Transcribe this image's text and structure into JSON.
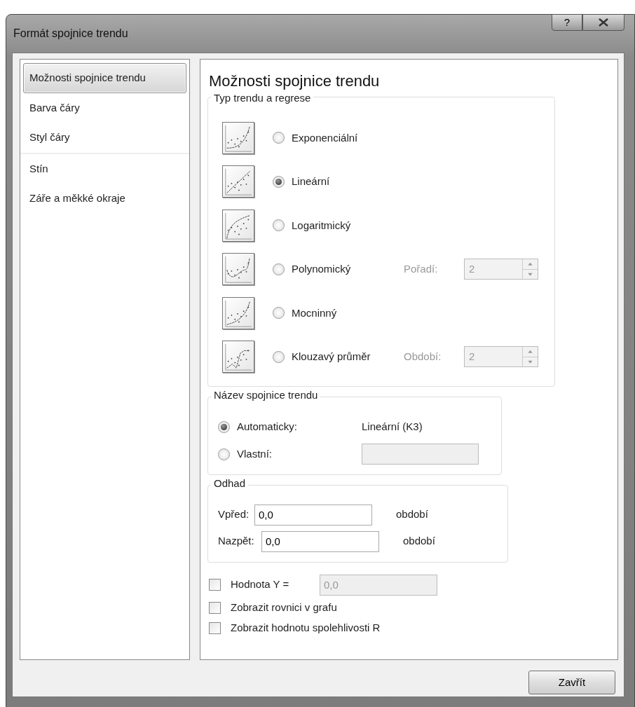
{
  "window": {
    "title": "Formát spojnice trendu",
    "help": "?"
  },
  "sidebar": {
    "items": [
      {
        "label": "Možnosti spojnice trendu",
        "selected": true,
        "divider_before": false
      },
      {
        "label": "Barva čáry",
        "selected": false,
        "divider_before": false
      },
      {
        "label": "Styl čáry",
        "selected": false,
        "divider_before": false
      },
      {
        "label": "Stín",
        "selected": false,
        "divider_before": true
      },
      {
        "label": "Záře a měkké okraje",
        "selected": false,
        "divider_before": false
      }
    ]
  },
  "panel": {
    "title": "Možnosti spojnice trendu",
    "trend_type": {
      "title": "Typ trendu a regrese",
      "options": [
        {
          "kind": "exponential",
          "label": "Exponenciální",
          "selected": false
        },
        {
          "kind": "linear",
          "label": "Lineární",
          "selected": true
        },
        {
          "kind": "logarithmic",
          "label": "Logaritmický",
          "selected": false
        },
        {
          "kind": "polynomial",
          "label": "Polynomický",
          "selected": false,
          "parameter": {
            "label": "Pořadí:",
            "value": "2",
            "disabled": true
          }
        },
        {
          "kind": "power",
          "label": "Mocninný",
          "selected": false
        },
        {
          "kind": "moving_average",
          "label": "Klouzavý průměr",
          "selected": false,
          "parameter": {
            "label": "Období:",
            "value": "2",
            "disabled": true
          }
        }
      ]
    },
    "trend_name": {
      "title": "Název spojnice trendu",
      "options": [
        {
          "kind": "text",
          "label": "Automaticky:",
          "selected": true,
          "value": "Lineární (K3)"
        },
        {
          "kind": "field",
          "label": "Vlastní:",
          "selected": false,
          "disabled": true
        }
      ]
    },
    "forecast": {
      "title": "Odhad",
      "rows": [
        {
          "label": "Vpřed:",
          "value": "0,0",
          "unit": "období"
        },
        {
          "label": "Nazpět:",
          "value": "0,0",
          "unit": "období"
        }
      ]
    },
    "checkboxes": [
      {
        "label": "Hodnota Y =",
        "checked": false,
        "field": {
          "value": "0,0",
          "disabled": true
        }
      },
      {
        "label": "Zobrazit rovnici v grafu",
        "checked": false
      },
      {
        "label": "Zobrazit hodnotu spolehlivosti R",
        "checked": false
      }
    ]
  },
  "buttons": [
    {
      "label": "Zavřít"
    }
  ]
}
